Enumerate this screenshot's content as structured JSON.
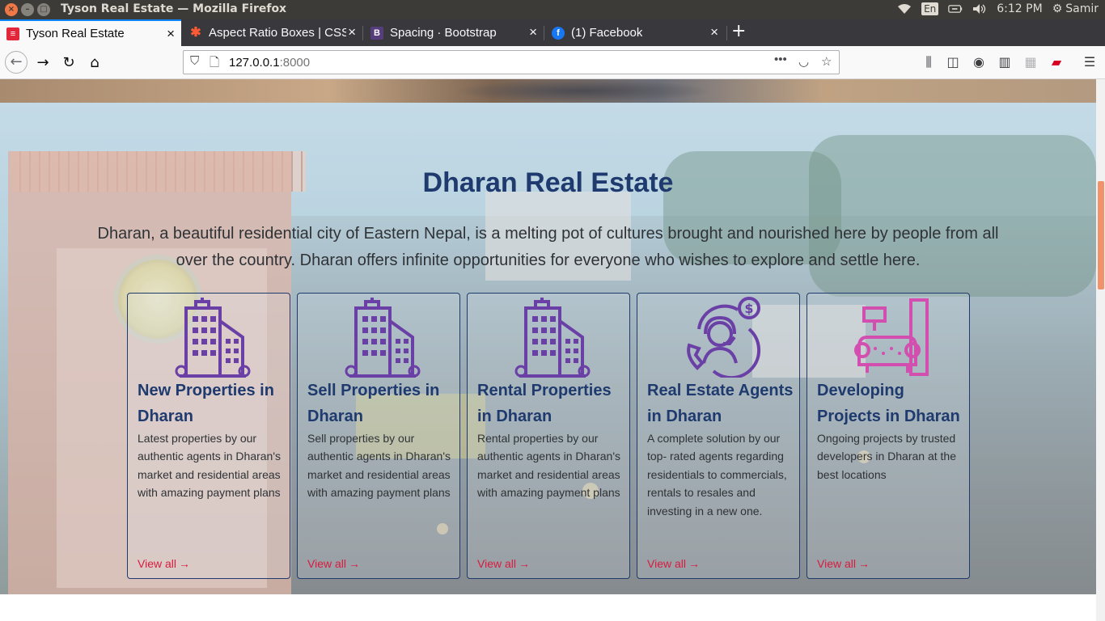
{
  "os": {
    "window_title": "Tyson Real Estate — Mozilla Firefox",
    "lang": "En",
    "clock": "6:12 PM",
    "user": "Samir"
  },
  "tabs": [
    {
      "label": "Tyson Real Estate",
      "active": true,
      "icon": "tyson-favicon"
    },
    {
      "label": "Aspect Ratio Boxes | CSS",
      "active": false,
      "icon": "css-tricks-favicon"
    },
    {
      "label": "Spacing · Bootstrap",
      "active": false,
      "icon": "bootstrap-favicon"
    },
    {
      "label": "(1) Facebook",
      "active": false,
      "icon": "facebook-favicon"
    }
  ],
  "nav": {
    "url_host": "127.0.0.1",
    "url_port": ":8000"
  },
  "section": {
    "title": "Dharan Real Estate",
    "description": "Dharan, a beautiful residential city of Eastern Nepal, is a melting pot of cultures brought and nourished here by people from all over the country. Dharan offers infinite opportunities for everyone who wishes to explore and settle here."
  },
  "cards": [
    {
      "title": "New Properties in Dharan",
      "text": "Latest properties by our authentic agents in Dharan's market and residential areas with amazing payment plans",
      "link": "View all",
      "icon": "building-icon"
    },
    {
      "title": "Sell Properties in Dharan",
      "text": "Sell properties by our authentic agents in Dharan's market and residential areas with amazing payment plans",
      "link": "View all",
      "icon": "building-icon"
    },
    {
      "title": "Rental Properties in Dharan",
      "text": "Rental properties by our authentic agents in Dharan's market and residential areas with amazing payment plans",
      "link": "View all",
      "icon": "building-icon"
    },
    {
      "title": "Real Estate Agents in Dharan",
      "text": "A complete solution by our top- rated agents regarding residentials to commercials, rentals to resales and investing in a new one.",
      "link": "View all",
      "icon": "agent-support-icon"
    },
    {
      "title": "Developing Projects in Dharan",
      "text": "Ongoing projects by trusted developers in Dharan at the best locations",
      "link": "View all",
      "icon": "furniture-icon"
    }
  ],
  "colors": {
    "heading": "#1f3a6e",
    "link": "#d81b3f",
    "icon_building": "#6a3fa6",
    "icon_furniture": "#d24fb0",
    "tab_accent": "#0a84ff"
  }
}
